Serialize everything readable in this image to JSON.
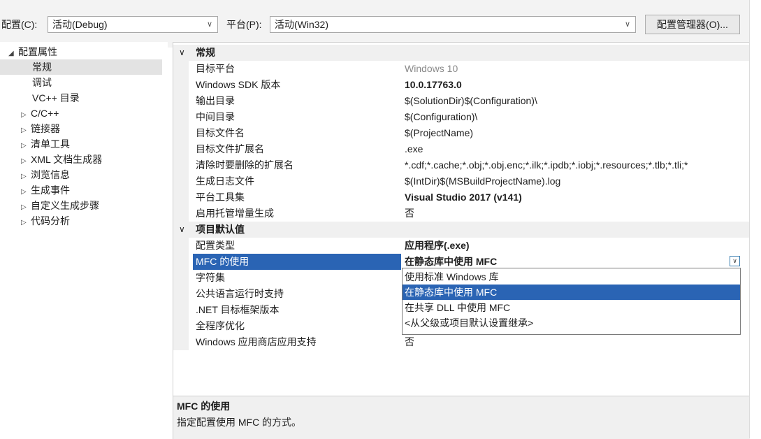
{
  "toolbar": {
    "config_label": "配置(C):",
    "config_value": "活动(Debug)",
    "platform_label": "平台(P):",
    "platform_value": "活动(Win32)",
    "config_manager_button": "配置管理器(O)..."
  },
  "tree": {
    "root": "配置属性",
    "items": [
      {
        "label": "常规",
        "expandable": false,
        "selected": true
      },
      {
        "label": "调试",
        "expandable": false
      },
      {
        "label": "VC++ 目录",
        "expandable": false
      },
      {
        "label": "C/C++",
        "expandable": true
      },
      {
        "label": "链接器",
        "expandable": true
      },
      {
        "label": "清单工具",
        "expandable": true
      },
      {
        "label": "XML 文档生成器",
        "expandable": true
      },
      {
        "label": "浏览信息",
        "expandable": true
      },
      {
        "label": "生成事件",
        "expandable": true
      },
      {
        "label": "自定义生成步骤",
        "expandable": true
      },
      {
        "label": "代码分析",
        "expandable": true
      }
    ]
  },
  "grid": {
    "sections": [
      {
        "title": "常规",
        "rows": [
          {
            "name": "目标平台",
            "value": "Windows 10",
            "style": "gray"
          },
          {
            "name": "Windows SDK 版本",
            "value": "10.0.17763.0",
            "style": "bold"
          },
          {
            "name": "输出目录",
            "value": "$(SolutionDir)$(Configuration)\\"
          },
          {
            "name": "中间目录",
            "value": "$(Configuration)\\"
          },
          {
            "name": "目标文件名",
            "value": "$(ProjectName)"
          },
          {
            "name": "目标文件扩展名",
            "value": ".exe"
          },
          {
            "name": "清除时要删除的扩展名",
            "value": "*.cdf;*.cache;*.obj;*.obj.enc;*.ilk;*.ipdb;*.iobj;*.resources;*.tlb;*.tli;*"
          },
          {
            "name": "生成日志文件",
            "value": "$(IntDir)$(MSBuildProjectName).log"
          },
          {
            "name": "平台工具集",
            "value": "Visual Studio 2017 (v141)",
            "style": "bold"
          },
          {
            "name": "启用托管增量生成",
            "value": "否"
          }
        ]
      },
      {
        "title": "项目默认值",
        "rows": [
          {
            "name": "配置类型",
            "value": "应用程序(.exe)",
            "style": "bold"
          },
          {
            "name": "MFC 的使用",
            "value": "在静态库中使用 MFC",
            "style": "selected"
          },
          {
            "name": "字符集",
            "value": ""
          },
          {
            "name": "公共语言运行时支持",
            "value": ""
          },
          {
            "name": ".NET 目标框架版本",
            "value": ""
          },
          {
            "name": "全程序优化",
            "value": ""
          },
          {
            "name": "Windows 应用商店应用支持",
            "value": "否"
          }
        ]
      }
    ]
  },
  "dropdown": {
    "options": [
      "使用标准 Windows 库",
      "在静态库中使用 MFC",
      "在共享 DLL 中使用 MFC",
      "<从父级或项目默认设置继承>"
    ],
    "highlighted_index": 1
  },
  "description": {
    "title": "MFC 的使用",
    "text": "指定配置使用 MFC 的方式。"
  }
}
